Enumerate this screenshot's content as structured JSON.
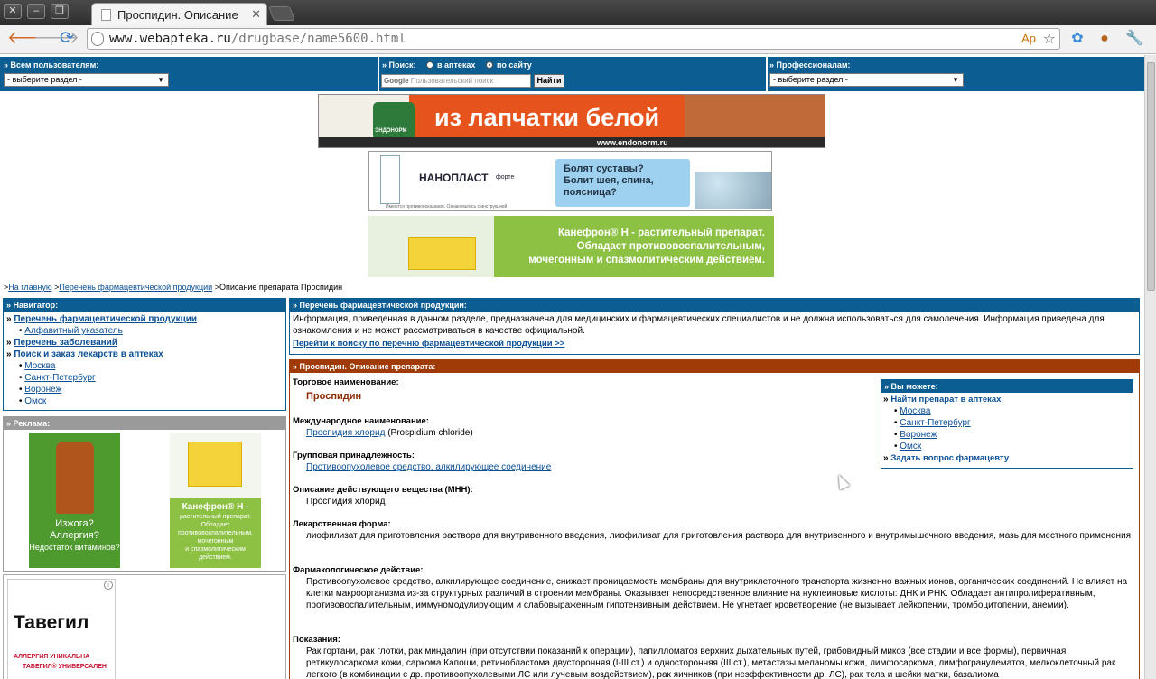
{
  "browser": {
    "tab_title": "Проспидин. Описание",
    "url_host": "www.webapteka.ru",
    "url_path": "/drugbase/name5600.html"
  },
  "topbar": {
    "users_label": "» Всем пользователям:",
    "users_select": "- выберите раздел -",
    "search_label": "» Поиск:",
    "radio_pharmacies": "в аптеках",
    "radio_site": "по сайту",
    "search_placeholder": "Пользовательский поиск",
    "search_button": "Найти",
    "pro_label": "» Профессионалам:",
    "pro_select": "- выберите раздел -"
  },
  "banners": {
    "b1_text": "из лапчатки белой",
    "b1_product": "ЭНДОНОРМ",
    "b1_url": "www.endonorm.ru",
    "b2_product": "НАНОПЛАСТ",
    "b2_sub": "форте",
    "b2_q1": "Болят суставы?",
    "b2_q2": "Болит шея, спина,",
    "b2_q3": "поясница?",
    "b2_note": "Имеются противопоказания. Ознакомьтесь с инструкцией",
    "b3_l1": "Канефрон® Н - растительный препарат.",
    "b3_l2": "Обладает противовоспалительным,",
    "b3_l3": "мочегонным и спазмолитическим действием."
  },
  "breadcrumb": {
    "home": "На главную",
    "list": "Перечень фармацевтической продукции",
    "current": "Описание препарата Проспидин"
  },
  "navigator": {
    "title": "» Навигатор:",
    "item1": "Перечень фармацевтической продукции",
    "item1_sub": "Алфавитный указатель",
    "item2": "Перечень заболеваний",
    "item3": "Поиск и заказ лекарств в аптеках",
    "cities": [
      "Москва",
      "Санкт-Петербург",
      "Воронеж",
      "Омск"
    ]
  },
  "ads": {
    "title": "» Реклама:",
    "ad1_l1": "Изжога?",
    "ad1_l2": "Аллергия?",
    "ad1_l3": "Недостаток витаминов?",
    "ad2_l1": "Канефрон® Н -",
    "ad2_l2": "растительный препарат.",
    "ad2_l3": "Обладает",
    "ad2_l4": "противовоспалительным,",
    "ad2_l5": "мочегонным",
    "ad2_l6": "и спазмолитическим",
    "ad2_l7": "действием.",
    "tavegil": "Тавегил",
    "tavegil_l1": "АЛЛЕРГИЯ УНИКАЛЬНА",
    "tavegil_l2": "ТАВЕГИЛ® УНИВЕРСАЛЕН"
  },
  "catalog": {
    "title": "» Перечень фармацевтической продукции:",
    "text": "Информация, приведенная в данном разделе, предназначена для медицинских и фармацевтических специалистов и не должна использоваться для самолечения. Информация приведена для ознакомления и не может рассматриваться в качестве официальной.",
    "link": "Перейти к поиску по перечню фармацевтической продукции >>"
  },
  "drug": {
    "title": "» Проспидин. Описание препарата:",
    "trade_label": "Торговое наименование:",
    "trade_value": "Проспидин",
    "intl_label": "Международное наименование:",
    "intl_link": "Проспидия хлорид",
    "intl_value": "(Prospidium chloride)",
    "group_label": "Групповая принадлежность:",
    "group_link": "Противоопухолевое средство, алкилирующее соединение",
    "mnn_label": "Описание действующего вещества (МНН):",
    "mnn_value": "Проспидия хлорид",
    "form_label": "Лекарственная форма:",
    "form_value": "лиофилизат для приготовления раствора для внутривенного введения, лиофилизат для приготовления раствора для внутривенного и внутримышечного введения, мазь для местного применения",
    "pharm_label": "Фармакологическое действие:",
    "pharm_value": "Противоопухолевое средство, алкилирующее соединение, снижает проницаемость мембраны для внутриклеточного транспорта жизненно важных ионов, органических соединений. Не влияет на клетки макроорганизма из-за структурных различий в строении мембраны. Оказывает непосредственное влияние на нуклеиновые кислоты: ДНК и РНК. Обладает антипролиферативным, противовоспалительным, иммуномодулирующим и слабовыраженным гипотензивным действием. Не угнетает кроветворение (не вызывает лейкопении, тромбоцитопении, анемии).",
    "ind_label": "Показания:",
    "ind_value": "Рак гортани, рак глотки, рак миндалин (при отсутствии показаний к операции), папилломатоз верхних дыхательных путей, грибовидный микоз (все стадии и все формы), первичная ретикулосаркома кожи, саркома Капоши, ретинобластома двусторонняя (I-III ст.) и односторонняя (III ст.), метастазы меланомы кожи, лимфосаркома, лимфогранулематоз, мелкоклеточный рак легкого (в комбинации с др. противоопухолевыми ЛС или лучевым воздействием), рак яичников (при неэффективности др. ЛС), рак тела и шейки матки, базалиома"
  },
  "youcan": {
    "title": "» Вы можете:",
    "find": "Найти препарат в аптеках",
    "cities": [
      "Москва",
      "Санкт-Петербург",
      "Воронеж",
      "Омск"
    ],
    "ask": "Задать вопрос фармацевту"
  }
}
